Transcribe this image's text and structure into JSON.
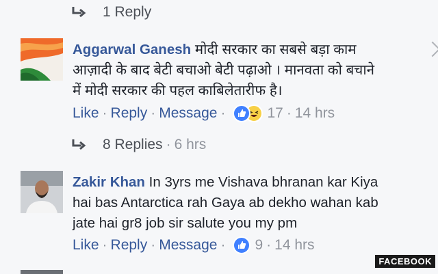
{
  "thread1": {
    "replies_label": "1 Reply"
  },
  "comment1": {
    "author": "Aggarwal Ganesh",
    "text_line1": "मोदी सरकार का सबसे बड़ा काम",
    "text_line2": "आज़ादी के बाद बेटी बचाओ बेटी पढ़ाओ । मानवता को बचाने",
    "text_line3": "में मोदी सरकार की पहल काबिलेतारीफ है।",
    "like_label": "Like",
    "reply_label": "Reply",
    "message_label": "Message",
    "reaction_count": "17",
    "time": "14 hrs",
    "replies_label": "8 Replies",
    "replies_time": "6 hrs"
  },
  "comment2": {
    "author": "Zakir Khan",
    "text_line1": "In 3yrs me Vishava bhranan kar Kiya",
    "text_line2": "hai bas Antarctica rah Gaya ab dekho wahan kab",
    "text_line3": "jate hai gr8 job sir salute you my pm",
    "like_label": "Like",
    "reply_label": "Reply",
    "message_label": "Message",
    "reaction_count": "9",
    "time": "14 hrs"
  },
  "icons": [
    "reply-arrow-icon",
    "like-reaction-icon",
    "haha-reaction-icon",
    "chevron-icon"
  ],
  "colors": {
    "link": "#365899",
    "muted": "#90949c",
    "like": "#4080ff",
    "haha": "#f7d046",
    "background": "#f6f7f9"
  },
  "watermark": "FACEBOOK"
}
